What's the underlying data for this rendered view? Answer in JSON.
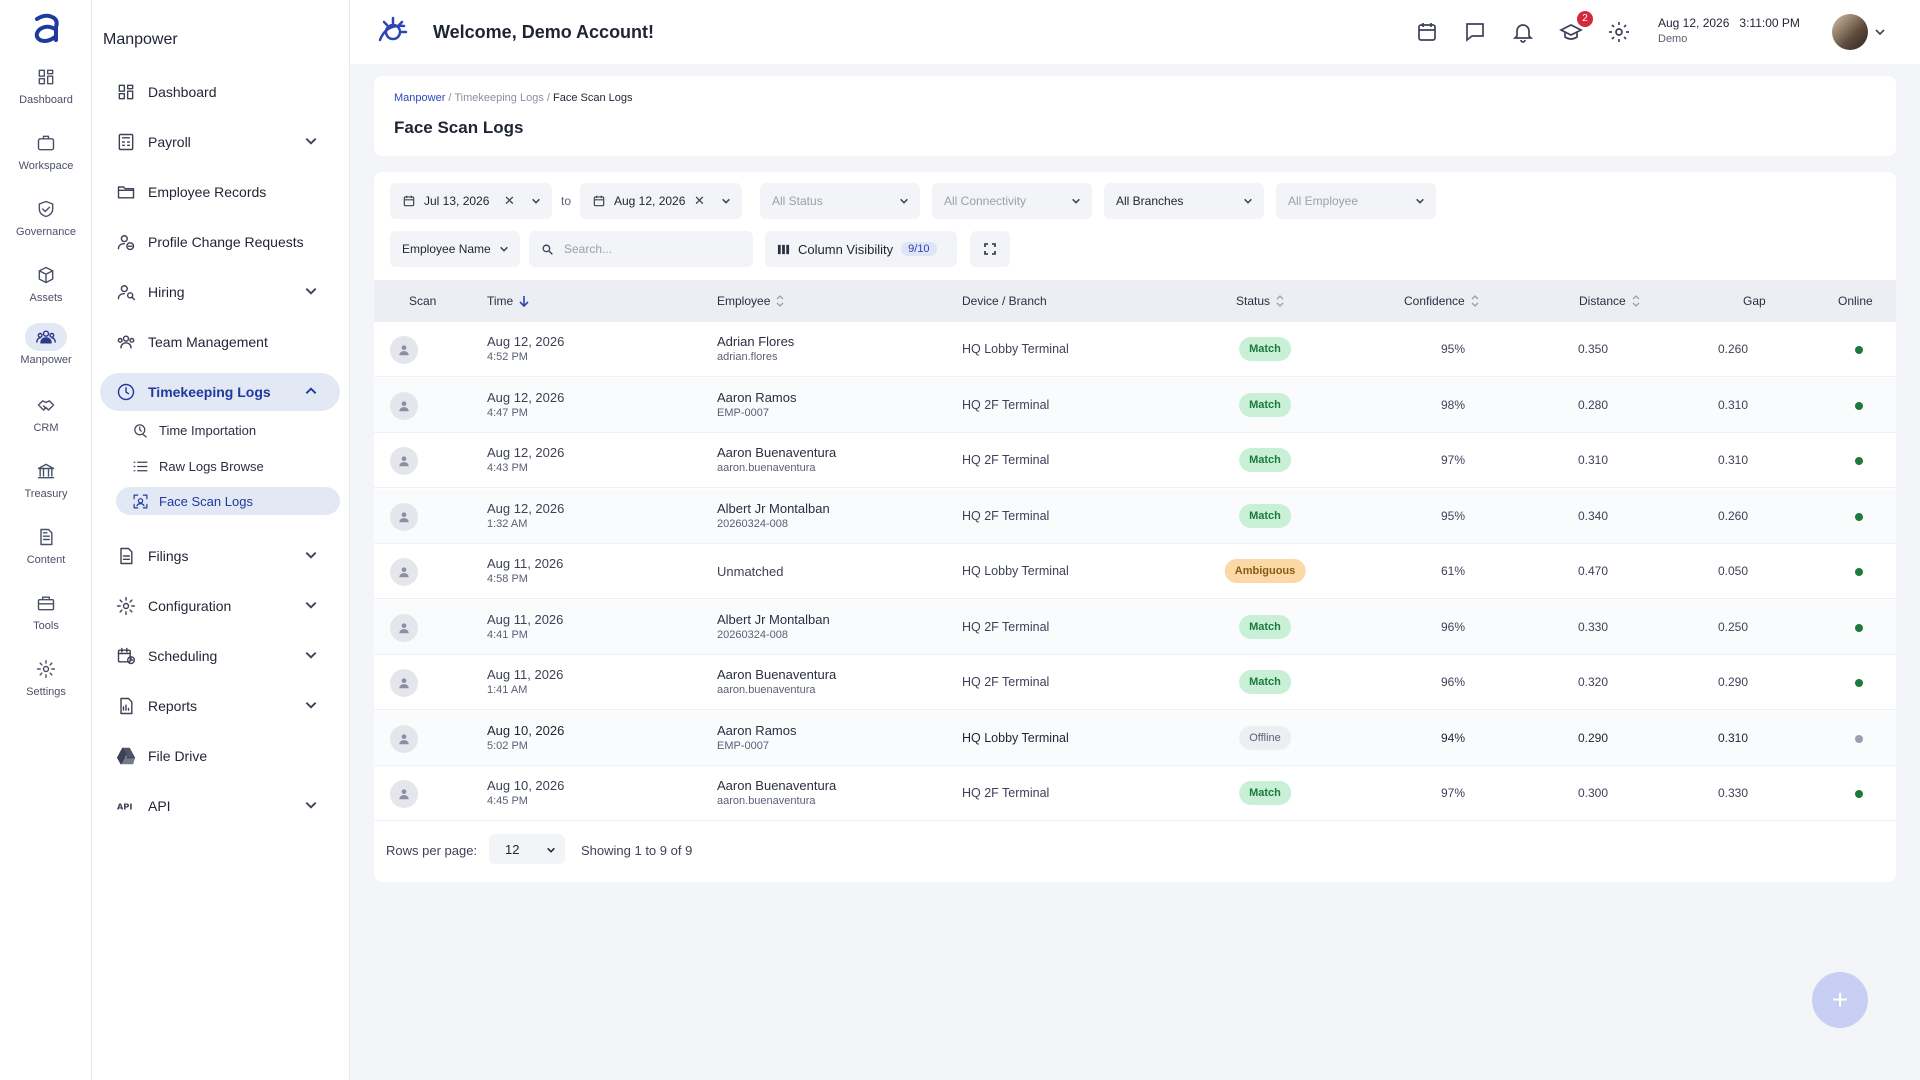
{
  "rail": {
    "items": [
      {
        "label": "Dashboard",
        "icon": "grid-icon"
      },
      {
        "label": "Workspace",
        "icon": "briefcase-icon"
      },
      {
        "label": "Governance",
        "icon": "shield-check-icon"
      },
      {
        "label": "Assets",
        "icon": "cube-icon"
      },
      {
        "label": "Manpower",
        "icon": "people-icon",
        "active": true
      },
      {
        "label": "CRM",
        "icon": "handshake-icon"
      },
      {
        "label": "Treasury",
        "icon": "bank-icon"
      },
      {
        "label": "Content",
        "icon": "document-icon"
      },
      {
        "label": "Tools",
        "icon": "toolbox-icon"
      },
      {
        "label": "Settings",
        "icon": "gear-icon"
      }
    ]
  },
  "sidebar": {
    "title": "Manpower",
    "items": [
      {
        "label": "Dashboard",
        "icon": "grid-icon",
        "chevron": false
      },
      {
        "label": "Payroll",
        "icon": "calculator-icon",
        "chevron": true
      },
      {
        "label": "Employee Records",
        "icon": "folder-icon",
        "chevron": false
      },
      {
        "label": "Profile Change Requests",
        "icon": "user-sync-icon",
        "chevron": false
      },
      {
        "label": "Hiring",
        "icon": "user-search-icon",
        "chevron": true
      },
      {
        "label": "Team Management",
        "icon": "team-icon",
        "chevron": false
      },
      {
        "label": "Timekeeping Logs",
        "icon": "clock-icon",
        "chevron": true,
        "open": true
      }
    ],
    "subitems": [
      {
        "label": "Time Importation",
        "icon": "clock-import-icon"
      },
      {
        "label": "Raw Logs Browse",
        "icon": "list-icon"
      },
      {
        "label": "Face Scan Logs",
        "icon": "face-scan-icon",
        "active": true
      }
    ],
    "items_after": [
      {
        "label": "Filings",
        "icon": "file-icon",
        "chevron": true
      },
      {
        "label": "Configuration",
        "icon": "gear-icon",
        "chevron": true
      },
      {
        "label": "Scheduling",
        "icon": "calendar-clock-icon",
        "chevron": true
      },
      {
        "label": "Reports",
        "icon": "report-icon",
        "chevron": true
      },
      {
        "label": "File Drive",
        "icon": "drive-icon",
        "chevron": false
      },
      {
        "label": "API",
        "icon": "api-icon",
        "chevron": true
      }
    ]
  },
  "topbar": {
    "welcome": "Welcome, Demo Account!",
    "notification_count": "2",
    "date": "Aug 12, 2026",
    "time": "3:11:00 PM",
    "user": "Demo"
  },
  "header": {
    "breadcrumbs": [
      "Manpower",
      "Timekeeping Logs",
      "Face Scan Logs"
    ],
    "title": "Face Scan Logs"
  },
  "filters": {
    "date_from": "Jul 13, 2026",
    "to_label": "to",
    "date_to": "Aug 12, 2026",
    "status": "All Status",
    "connectivity": "All Connectivity",
    "branches": "All Branches",
    "employee": "All Employee",
    "search_field": "Employee Name",
    "search_placeholder": "Search...",
    "column_visibility_label": "Column Visibility",
    "column_visibility_count": "9/10"
  },
  "table": {
    "columns": [
      "Scan",
      "Time",
      "Employee",
      "Device / Branch",
      "Status",
      "Confidence",
      "Distance",
      "Gap",
      "Online"
    ],
    "rows": [
      {
        "date": "Aug 12, 2026",
        "time": "4:52 PM",
        "employee": "Adrian Flores",
        "employee_id": "adrian.flores",
        "device": "HQ Lobby Terminal",
        "status": "Match",
        "confidence": "95%",
        "distance": "0.350",
        "gap": "0.260",
        "online": true
      },
      {
        "date": "Aug 12, 2026",
        "time": "4:47 PM",
        "employee": "Aaron Ramos",
        "employee_id": "EMP-0007",
        "device": "HQ 2F Terminal",
        "status": "Match",
        "confidence": "98%",
        "distance": "0.280",
        "gap": "0.310",
        "online": true
      },
      {
        "date": "Aug 12, 2026",
        "time": "4:43 PM",
        "employee": "Aaron Buenaventura",
        "employee_id": "aaron.buenaventura",
        "device": "HQ 2F Terminal",
        "status": "Match",
        "confidence": "97%",
        "distance": "0.310",
        "gap": "0.310",
        "online": true
      },
      {
        "date": "Aug 12, 2026",
        "time": "1:32 AM",
        "employee": "Albert Jr Montalban",
        "employee_id": "20260324-008",
        "device": "HQ 2F Terminal",
        "status": "Match",
        "confidence": "95%",
        "distance": "0.340",
        "gap": "0.260",
        "online": true
      },
      {
        "date": "Aug 11, 2026",
        "time": "4:58 PM",
        "employee": "Unmatched",
        "employee_id": "",
        "device": "HQ Lobby Terminal",
        "status": "Ambiguous",
        "confidence": "61%",
        "distance": "0.470",
        "gap": "0.050",
        "online": true
      },
      {
        "date": "Aug 11, 2026",
        "time": "4:41 PM",
        "employee": "Albert Jr Montalban",
        "employee_id": "20260324-008",
        "device": "HQ 2F Terminal",
        "status": "Match",
        "confidence": "96%",
        "distance": "0.330",
        "gap": "0.250",
        "online": true
      },
      {
        "date": "Aug 11, 2026",
        "time": "1:41 AM",
        "employee": "Aaron Buenaventura",
        "employee_id": "aaron.buenaventura",
        "device": "HQ 2F Terminal",
        "status": "Match",
        "confidence": "96%",
        "distance": "0.320",
        "gap": "0.290",
        "online": true
      },
      {
        "date": "Aug 10, 2026",
        "time": "5:02 PM",
        "employee": "Aaron Ramos",
        "employee_id": "EMP-0007",
        "device": "HQ Lobby Terminal",
        "status": "Offline",
        "confidence": "94%",
        "distance": "0.290",
        "gap": "0.310",
        "online": false
      },
      {
        "date": "Aug 10, 2026",
        "time": "4:45 PM",
        "employee": "Aaron Buenaventura",
        "employee_id": "aaron.buenaventura",
        "device": "HQ 2F Terminal",
        "status": "Match",
        "confidence": "97%",
        "distance": "0.300",
        "gap": "0.330",
        "online": true
      }
    ]
  },
  "pagination": {
    "rows_per_page_label": "Rows per page:",
    "rows_per_page": "12",
    "showing": "Showing 1 to 9 of 9"
  },
  "colors": {
    "accent": "#1f3a9e",
    "match_bg": "#c9f0d6",
    "match_fg": "#1b7a3e",
    "ambiguous_bg": "#fbd9a6",
    "ambiguous_fg": "#8a5a12",
    "offline_bg": "#eceef2",
    "offline_fg": "#5a6075",
    "online_dot": "#1d7a3a",
    "offline_dot": "#9aa0ad"
  }
}
